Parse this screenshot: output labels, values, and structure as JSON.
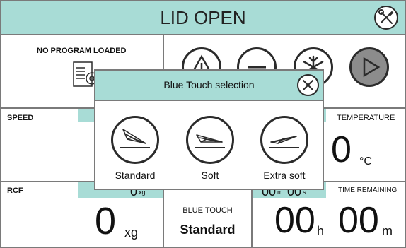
{
  "header": {
    "title": "LID OPEN",
    "settings_icon": "wrench-screwdriver-icon"
  },
  "program": {
    "status": "NO PROGRAM LOADED",
    "icon": "program-file-gear-icon"
  },
  "controls": {
    "icons": [
      "warning-triangle-icon",
      "minus-icon",
      "snowflake-icon",
      "play-icon"
    ]
  },
  "speed": {
    "label": "SPEED"
  },
  "temperature": {
    "label": "TEMPERATURE",
    "value": "0",
    "unit": "°C"
  },
  "rcf": {
    "label": "RCF",
    "setpoint_value": "0",
    "setpoint_unit": "xg",
    "value": "0",
    "unit": "xg"
  },
  "blue_touch": {
    "label": "BLUE TOUCH",
    "value": "Standard"
  },
  "time": {
    "setpoint_minutes": "00",
    "setpoint_minutes_unit": "m",
    "setpoint_seconds": "00",
    "setpoint_seconds_unit": "s",
    "label": "TIME REMAINING",
    "hours": "00",
    "hours_unit": "h",
    "minutes": "00",
    "minutes_unit": "m"
  },
  "dialog": {
    "title": "Blue Touch selection",
    "close_icon": "close-icon",
    "options": [
      {
        "label": "Standard",
        "icon": "paper-plane-standard-icon"
      },
      {
        "label": "Soft",
        "icon": "paper-plane-soft-icon"
      },
      {
        "label": "Extra soft",
        "icon": "paper-plane-extra-soft-icon"
      }
    ]
  },
  "colors": {
    "accent": "#a8dcd6",
    "border": "#7a7a7a",
    "play_button": "#8c8c8c"
  }
}
